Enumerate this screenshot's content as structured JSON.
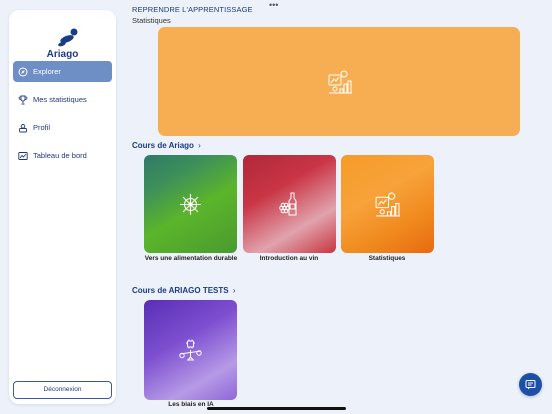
{
  "sidebar": {
    "brand": "Ariago",
    "items": [
      {
        "label": "Explorer",
        "icon": "compass-icon",
        "active": true
      },
      {
        "label": "Mes statistiques",
        "icon": "trophy-icon",
        "active": false
      },
      {
        "label": "Profil",
        "icon": "profile-icon",
        "active": false
      },
      {
        "label": "Tableau de bord",
        "icon": "chart-icon",
        "active": false
      }
    ],
    "logout_label": "Déconnexion"
  },
  "resume": {
    "title": "REPRENDRE L'APPRENTISSAGE",
    "subtitle": "Statistiques",
    "card_color": "#f7ad52",
    "icon": "statistics-icon"
  },
  "sections": [
    {
      "title": "Cours de Ariago",
      "courses": [
        {
          "label": "Vers une alimentation durable",
          "icon": "food-wheel-icon",
          "color": "#4a9a30"
        },
        {
          "label": "Introduction au vin",
          "icon": "wine-icon",
          "color": "#c93545"
        },
        {
          "label": "Statistiques",
          "icon": "statistics-icon",
          "color": "#f59b28"
        }
      ]
    },
    {
      "title": "Cours de ARIAGO TESTS",
      "courses": [
        {
          "label": "Les biais en IA",
          "icon": "ai-balance-icon",
          "color": "#7d4fd0"
        }
      ]
    }
  ],
  "accent": "#1d4fa8"
}
